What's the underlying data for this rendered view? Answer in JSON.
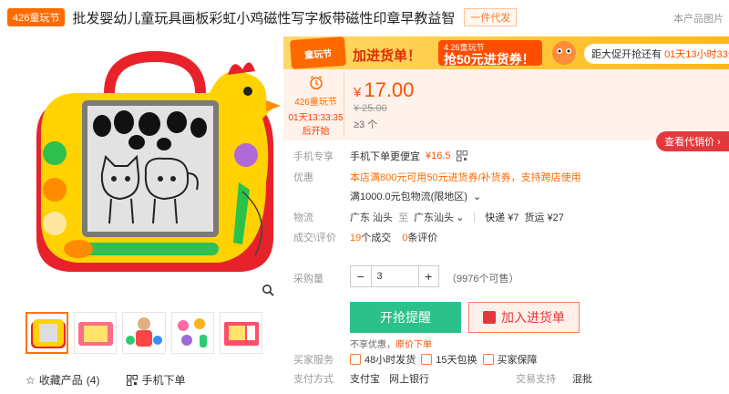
{
  "header": {
    "festival_tag": "426童玩节",
    "title": "批发婴幼儿童玩具画板彩虹小鸡磁性写字板带磁性印章早教益智",
    "dropship_badge": "一件代发",
    "meta_link": "本产品图片"
  },
  "promo": {
    "badge_top": "4.26",
    "badge_text": "童玩节",
    "main": "加进货单！",
    "sub_top": "4.26童玩节",
    "sub": "抢50元进货券！",
    "countdown_label": "距大促开抢还有",
    "countdown_time": "01天13小时33分35秒"
  },
  "sale": {
    "tag": "426童玩节",
    "time": "01天13:33:35",
    "start": "后开始"
  },
  "price": {
    "currency": "¥",
    "now": "17.00",
    "old": "¥ 25.00",
    "moq": "≥3 个"
  },
  "rows": {
    "mobile_label": "手机专享",
    "mobile_text": "手机下单更便宜",
    "mobile_price": "¥16.5",
    "coupon_label": "优惠",
    "coupon_text": "本店满800元可用50元进货券/补货券，支持跨店使用",
    "free_ship": "满1000.0元包物流(限地区)",
    "ship_label": "物流",
    "ship_from": "广东 汕头",
    "ship_to_word": "至",
    "ship_to": "广东汕头",
    "ship_express": "快递 ¥7",
    "ship_freight": "货运 ¥27",
    "deals_label": "成交\\评价",
    "deals_count": "19",
    "deals_unit": "个成交",
    "reviews_count": "0",
    "reviews_unit": "条评价",
    "agent_btn": "查看代销价 ›"
  },
  "purchase": {
    "qty_label": "采购量",
    "qty_minus": "−",
    "qty_value": "3",
    "qty_plus": "+",
    "stock": "（9976个可售）",
    "buy_btn": "开抢提醒",
    "cart_btn": "加入进货单",
    "note_prefix": "不享优惠，",
    "note_link": "原价下单"
  },
  "services": {
    "label": "买家服务",
    "items": [
      "48小时发货",
      "15天包换",
      "买家保障"
    ]
  },
  "payment": {
    "label": "支付方式",
    "methods": [
      "支付宝",
      "网上银行"
    ],
    "trade_label": "交易支持",
    "trade_value": "混批"
  },
  "gallery": {
    "collect": "收藏产品",
    "collect_count": "(4)",
    "mobile_order": "手机下单"
  }
}
